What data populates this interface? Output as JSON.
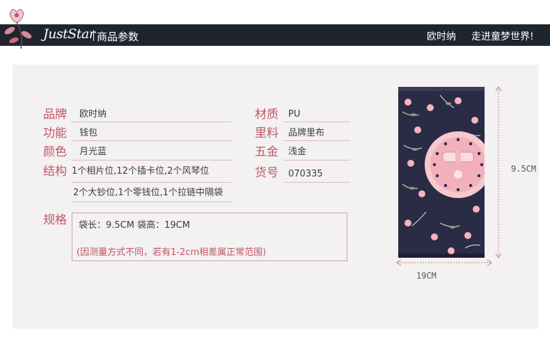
{
  "header": {
    "brand": "JustStar",
    "title": "商品参数",
    "right_1": "欧时纳",
    "right_2": "走进童梦世界!"
  },
  "params": {
    "brand": {
      "label": "品牌",
      "value": "欧时纳"
    },
    "function": {
      "label": "功能",
      "value": "钱包"
    },
    "color": {
      "label": "颜色",
      "value": "月光蓝"
    },
    "structure": {
      "label": "结构",
      "value_line1": "1个相片位,12个插卡位,2个风琴位",
      "value_line2": "2个大钞位,1个零钱位,1个拉链中隔袋"
    },
    "material": {
      "label": "材质",
      "value": "PU"
    },
    "lining": {
      "label": "里料",
      "value": "品牌里布"
    },
    "hardware": {
      "label": "五金",
      "value": "浅金"
    },
    "item_no": {
      "label": "货号",
      "value": "070335"
    },
    "spec": {
      "label": "规格",
      "line1": "袋长：9.5CM  袋高：19CM",
      "line2": "(因测量方式不同，若有1-2cm相差属正常范围)"
    }
  },
  "dimensions": {
    "height_label": "9.5CM",
    "width_label": "19CM"
  },
  "colors": {
    "header_bg": "#1f2530",
    "label": "#c1566a",
    "panel_bg": "#f3f1f1",
    "wallet_bg": "#2a2b45",
    "wallet_accent": "#f4b3bd"
  }
}
